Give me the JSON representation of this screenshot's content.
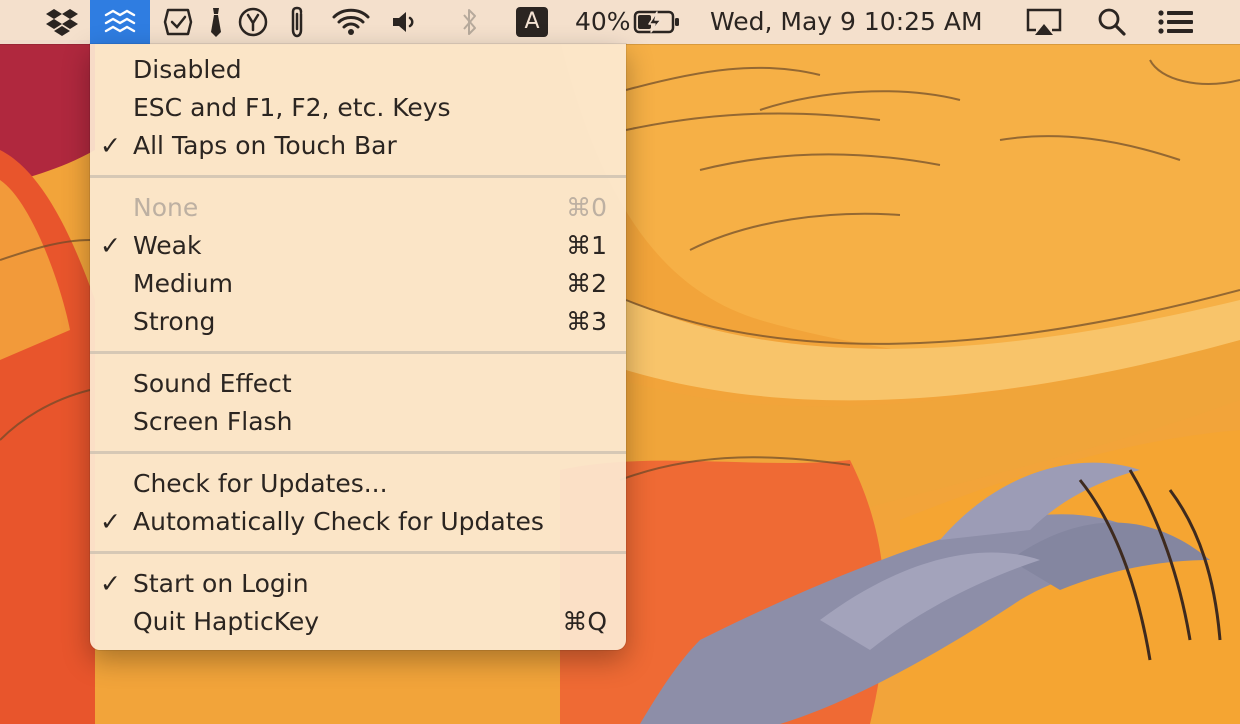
{
  "menubar": {
    "icons": [
      "dropbox-icon",
      "haptickey-icon",
      "task-check-icon",
      "tie-icon",
      "y-circle-icon",
      "paperclip-icon",
      "wifi-icon",
      "volume-icon",
      "bluetooth-icon"
    ],
    "input_source": "A",
    "battery_percent": "40%",
    "battery_icon": "battery-charging-icon",
    "clock": "Wed, May 9  10:25 AM",
    "right_icons": [
      "airplay-icon",
      "spotlight-search-icon",
      "notification-center-icon"
    ],
    "active_color": "#2f7de1"
  },
  "menu": {
    "check_glyph": "✓",
    "groups": [
      {
        "items": [
          {
            "label": "Disabled",
            "checked": false,
            "shortcut": "",
            "enabled": true
          },
          {
            "label": "ESC and F1, F2, etc. Keys",
            "checked": false,
            "shortcut": "",
            "enabled": true
          },
          {
            "label": "All Taps on Touch Bar",
            "checked": true,
            "shortcut": "",
            "enabled": true
          }
        ]
      },
      {
        "items": [
          {
            "label": "None",
            "checked": false,
            "shortcut": "⌘0",
            "enabled": false
          },
          {
            "label": "Weak",
            "checked": true,
            "shortcut": "⌘1",
            "enabled": true
          },
          {
            "label": "Medium",
            "checked": false,
            "shortcut": "⌘2",
            "enabled": true
          },
          {
            "label": "Strong",
            "checked": false,
            "shortcut": "⌘3",
            "enabled": true
          }
        ]
      },
      {
        "items": [
          {
            "label": "Sound Effect",
            "checked": false,
            "shortcut": "",
            "enabled": true
          },
          {
            "label": "Screen Flash",
            "checked": false,
            "shortcut": "",
            "enabled": true
          }
        ]
      },
      {
        "items": [
          {
            "label": "Check for Updates...",
            "checked": false,
            "shortcut": "",
            "enabled": true
          },
          {
            "label": "Automatically Check for Updates",
            "checked": true,
            "shortcut": "",
            "enabled": true
          }
        ]
      },
      {
        "items": [
          {
            "label": "Start on Login",
            "checked": true,
            "shortcut": "",
            "enabled": true
          },
          {
            "label": "Quit HapticKey",
            "checked": false,
            "shortcut": "⌘Q",
            "enabled": true
          }
        ]
      }
    ]
  }
}
